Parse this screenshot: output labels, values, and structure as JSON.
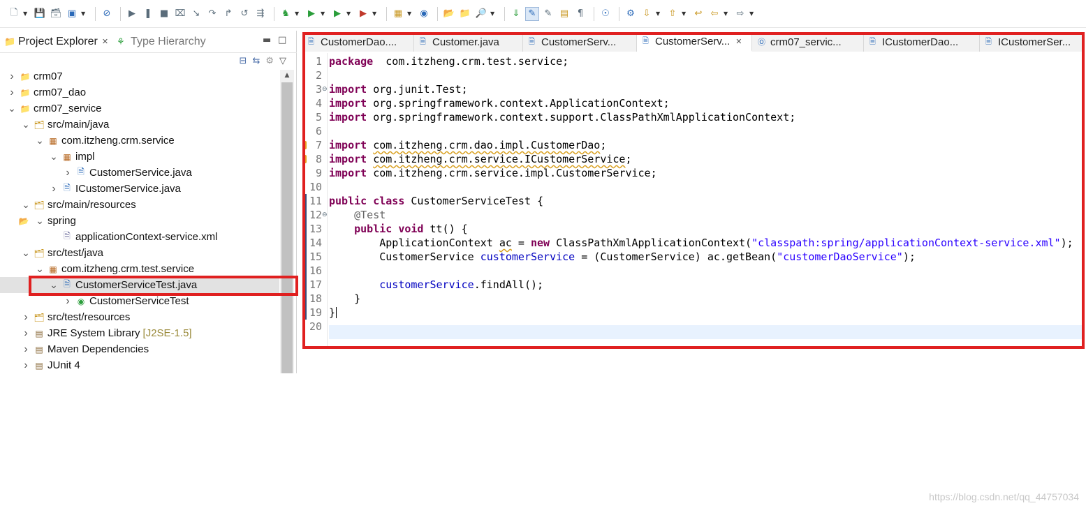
{
  "toolbar": {
    "buttons": [
      "new-icon",
      "save-icon",
      "save-all-icon",
      "print-icon",
      "skip-breakpoints-icon",
      "resume-icon",
      "suspend-icon",
      "terminate-icon",
      "disconnect-icon",
      "step-into-icon",
      "step-over-icon",
      "step-return-icon",
      "drop-frame-icon",
      "use-step-filters-icon",
      "debug-icon",
      "run-icon",
      "run-ext-icon",
      "coverage-icon",
      "new-server-icon",
      "new-java-icon",
      "open-type-icon",
      "open-task-icon",
      "search-icon",
      "next-annotation-icon",
      "highlight-icon",
      "toggle-mark-icon",
      "block-select-icon",
      "show-whitespace-icon",
      "globe-icon",
      "external-tools-icon",
      "next-edit-icon",
      "prev-edit-icon",
      "last-edit-icon",
      "back-icon",
      "forward-icon"
    ]
  },
  "left_panel": {
    "tabs": [
      {
        "label": "Project Explorer",
        "active": true
      },
      {
        "label": "Type Hierarchy",
        "active": false
      }
    ],
    "tree": [
      {
        "label": "crm07",
        "icon": "project-icon",
        "indent": 0,
        "twisty": ">"
      },
      {
        "label": "crm07_dao",
        "icon": "maven-project-icon",
        "indent": 0,
        "twisty": ">"
      },
      {
        "label": "crm07_service",
        "icon": "maven-project-icon",
        "indent": 0,
        "twisty": "v"
      },
      {
        "label": "src/main/java",
        "icon": "source-folder-icon",
        "indent": 1,
        "twisty": "v"
      },
      {
        "label": "com.itzheng.crm.service",
        "icon": "package-icon",
        "indent": 2,
        "twisty": "v"
      },
      {
        "label": "impl",
        "icon": "package-icon",
        "indent": 3,
        "twisty": "v"
      },
      {
        "label": "CustomerService.java",
        "icon": "java-file-icon",
        "indent": 4,
        "twisty": ">"
      },
      {
        "label": "ICustomerService.java",
        "icon": "java-interface-file-icon",
        "indent": 3,
        "twisty": ">"
      },
      {
        "label": "src/main/resources",
        "icon": "source-folder-icon",
        "indent": 1,
        "twisty": "v"
      },
      {
        "label": "spring",
        "icon": "folder-icon",
        "indent": 2,
        "twisty": "v"
      },
      {
        "label": "applicationContext-service.xml",
        "icon": "xml-file-icon",
        "indent": 3,
        "twisty": ""
      },
      {
        "label": "src/test/java",
        "icon": "source-folder-icon",
        "indent": 1,
        "twisty": "v"
      },
      {
        "label": "com.itzheng.crm.test.service",
        "icon": "package-icon",
        "indent": 2,
        "twisty": "v"
      },
      {
        "label": "CustomerServiceTest.java",
        "icon": "java-file-icon",
        "indent": 3,
        "twisty": "v",
        "selected": true
      },
      {
        "label": "CustomerServiceTest",
        "icon": "class-icon",
        "indent": 4,
        "twisty": ">"
      },
      {
        "label": "src/test/resources",
        "icon": "source-folder-icon",
        "indent": 1,
        "twisty": ">"
      },
      {
        "label": "JRE System Library",
        "ext": "[J2SE-1.5]",
        "icon": "library-icon",
        "indent": 1,
        "twisty": ">"
      },
      {
        "label": "Maven Dependencies",
        "icon": "library-icon",
        "indent": 1,
        "twisty": ">"
      },
      {
        "label": "JUnit 4",
        "icon": "library-icon",
        "indent": 1,
        "twisty": ">"
      }
    ]
  },
  "editor": {
    "tabs": [
      {
        "label": "CustomerDao....",
        "active": false,
        "icon": "java-file-icon"
      },
      {
        "label": "Customer.java",
        "active": false,
        "icon": "java-file-icon"
      },
      {
        "label": "CustomerServ...",
        "active": false,
        "icon": "java-file-icon"
      },
      {
        "label": "CustomerServ...",
        "active": true,
        "icon": "java-file-icon"
      },
      {
        "label": "crm07_servic...",
        "active": false,
        "icon": "maven-pom-icon"
      },
      {
        "label": "ICustomerDao...",
        "active": false,
        "icon": "java-file-icon"
      },
      {
        "label": "ICustomerSer...",
        "active": false,
        "icon": "java-file-icon"
      }
    ],
    "lines": [
      {
        "no": "1",
        "tokens": [
          [
            "kw",
            "package"
          ],
          [
            "",
            "  com.itzheng.crm.test.service;"
          ]
        ]
      },
      {
        "no": "2",
        "tokens": []
      },
      {
        "no": "3",
        "fold": true,
        "tokens": [
          [
            "kw",
            "import"
          ],
          [
            "",
            " org.junit.Test;"
          ]
        ]
      },
      {
        "no": "4",
        "tokens": [
          [
            "kw",
            "import"
          ],
          [
            "",
            " org.springframework.context.ApplicationContext;"
          ]
        ]
      },
      {
        "no": "5",
        "tokens": [
          [
            "kw",
            "import"
          ],
          [
            "",
            " org.springframework.context.support.ClassPathXmlApplicationContext;"
          ]
        ]
      },
      {
        "no": "6",
        "tokens": []
      },
      {
        "no": "7",
        "warn": true,
        "tokens": [
          [
            "kw",
            "import"
          ],
          [
            "",
            " "
          ],
          [
            "wavy",
            "com.itzheng.crm.dao.impl.CustomerDao"
          ],
          [
            "",
            ";"
          ]
        ]
      },
      {
        "no": "8",
        "warn": true,
        "tokens": [
          [
            "kw",
            "import"
          ],
          [
            "",
            " "
          ],
          [
            "wavy",
            "com.itzheng.crm.service.ICustomerService"
          ],
          [
            "",
            ";"
          ]
        ]
      },
      {
        "no": "9",
        "tokens": [
          [
            "kw",
            "import"
          ],
          [
            "",
            " com.itzheng.crm.service.impl.CustomerService;"
          ]
        ]
      },
      {
        "no": "10",
        "tokens": []
      },
      {
        "no": "11",
        "tokens": [
          [
            "kw",
            "public"
          ],
          [
            "",
            " "
          ],
          [
            "kw",
            "class"
          ],
          [
            "",
            " CustomerServiceTest {"
          ]
        ]
      },
      {
        "no": "12",
        "fold": true,
        "tokens": [
          [
            "",
            "    "
          ],
          [
            "ann",
            "@Test"
          ]
        ]
      },
      {
        "no": "13",
        "tokens": [
          [
            "",
            "    "
          ],
          [
            "kw",
            "public"
          ],
          [
            "",
            " "
          ],
          [
            "kw",
            "void"
          ],
          [
            "",
            " tt() {"
          ]
        ]
      },
      {
        "no": "14",
        "warn": true,
        "tokens": [
          [
            "",
            "        ApplicationContext "
          ],
          [
            "wavy",
            "ac"
          ],
          [
            "",
            " = "
          ],
          [
            "kw",
            "new"
          ],
          [
            "",
            " ClassPathXmlApplicationContext("
          ],
          [
            "str",
            "\"classpath:spring/applicationContext-service.xml\""
          ],
          [
            "",
            ");"
          ]
        ]
      },
      {
        "no": "15",
        "tokens": [
          [
            "",
            "        CustomerService "
          ],
          [
            "fld",
            "customerService"
          ],
          [
            "",
            " = (CustomerService) ac.getBean("
          ],
          [
            "str",
            "\"customerDaoService\""
          ],
          [
            "",
            ");"
          ]
        ]
      },
      {
        "no": "16",
        "tokens": []
      },
      {
        "no": "17",
        "tokens": [
          [
            "",
            "        "
          ],
          [
            "fld",
            "customerService"
          ],
          [
            "",
            ".findAll();"
          ]
        ]
      },
      {
        "no": "18",
        "tokens": [
          [
            "",
            "    }"
          ]
        ]
      },
      {
        "no": "19",
        "tokens": [
          [
            "",
            "}"
          ]
        ]
      },
      {
        "no": "20",
        "tokens": []
      }
    ]
  },
  "watermark": "https://blog.csdn.net/qq_44757034",
  "colors": {
    "highlight_box": "#e02020",
    "keyword": "#7f0055",
    "string": "#2a00ff",
    "field": "#0000c0"
  }
}
